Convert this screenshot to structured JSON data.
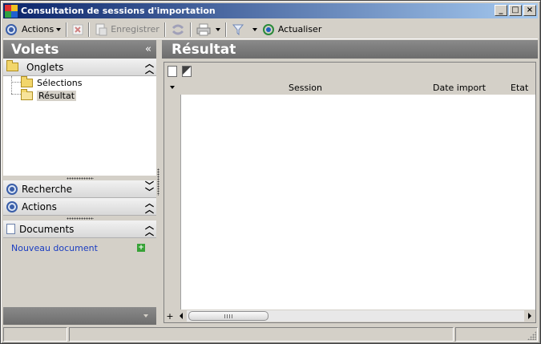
{
  "window": {
    "title": "Consultation de sessions d'importation",
    "controls": [
      "_",
      "□",
      "×"
    ]
  },
  "toolbar": {
    "actions_label": "Actions",
    "save_label": "Enregistrer",
    "refresh_label": "Actualiser",
    "icons": [
      "actions-icon",
      "delete-icon",
      "save-icon",
      "sync-icon",
      "print-icon",
      "filter-icon",
      "refresh-icon"
    ]
  },
  "left_panel": {
    "title": "Volets",
    "collapse_glyph": "«",
    "onglets": {
      "label": "Onglets",
      "items": [
        {
          "label": "Sélections",
          "selected": false
        },
        {
          "label": "Résultat",
          "selected": true
        }
      ]
    },
    "recherche": {
      "label": "Recherche"
    },
    "actions": {
      "label": "Actions"
    },
    "documents": {
      "label": "Documents",
      "new_doc_link": "Nouveau document"
    }
  },
  "right_panel": {
    "title": "Résultat",
    "columns": [
      "Session",
      "Date import",
      "Etat"
    ],
    "rows": []
  },
  "colors": {
    "titlebar_start": "#0a246a",
    "titlebar_end": "#a6caf0",
    "panel_header": "#7a7a7a",
    "link": "#1a3dc1",
    "face": "#d4d0c8"
  }
}
